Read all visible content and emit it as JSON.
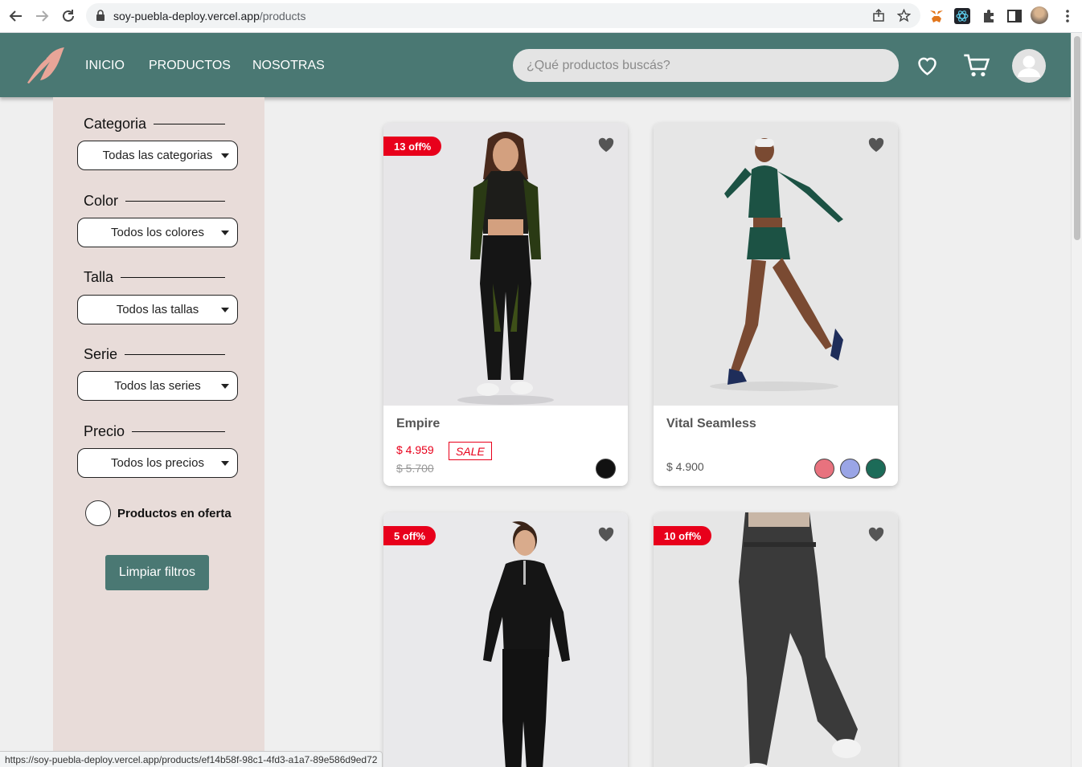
{
  "browser": {
    "url_host": "soy-puebla-deploy.vercel.app",
    "url_path": "/products",
    "status_url": "https://soy-puebla-deploy.vercel.app/products/ef14b58f-98c1-4fd3-a1a7-89e586d9ed72",
    "icons": [
      "back-icon",
      "forward-icon",
      "reload-icon",
      "lock-icon",
      "share-icon",
      "star-icon",
      "metamask-icon",
      "react-devtools-icon",
      "extensions-icon",
      "sidepanel-icon",
      "profile-icon",
      "menu-icon"
    ]
  },
  "header": {
    "nav": [
      "INICIO",
      "PRODUCTOS",
      "NOSOTRAS"
    ],
    "search_placeholder": "¿Qué productos buscás?",
    "icons": [
      "logo-icon",
      "heart-icon",
      "cart-icon",
      "user-icon"
    ],
    "colors": {
      "header_bg": "#4a7873",
      "logo": "#e8a598"
    }
  },
  "sidebar": {
    "filters": [
      {
        "title": "Categoria",
        "value": "Todas las categorias"
      },
      {
        "title": "Color",
        "value": "Todos los colores"
      },
      {
        "title": "Talla",
        "value": "Todos las tallas"
      },
      {
        "title": "Serie",
        "value": "Todos las series"
      },
      {
        "title": "Precio",
        "value": "Todos los precios"
      }
    ],
    "offer_label": "Productos en oferta",
    "clear_label": "Limpiar filtros",
    "colors": {
      "bg": "#e8dcd9"
    }
  },
  "products": [
    {
      "name": "Empire",
      "badge": "13 off%",
      "price": "$ 4.959",
      "sale": "SALE",
      "old_price": "$ 5.700",
      "colors": [
        "#111111"
      ]
    },
    {
      "name": "Vital Seamless",
      "badge": "",
      "price": "$ 4.900",
      "colors": [
        "#e8727e",
        "#9aa5e6",
        "#1c6b58"
      ]
    },
    {
      "name": "",
      "badge": "5 off%"
    },
    {
      "name": "",
      "badge": "10 off%"
    }
  ]
}
